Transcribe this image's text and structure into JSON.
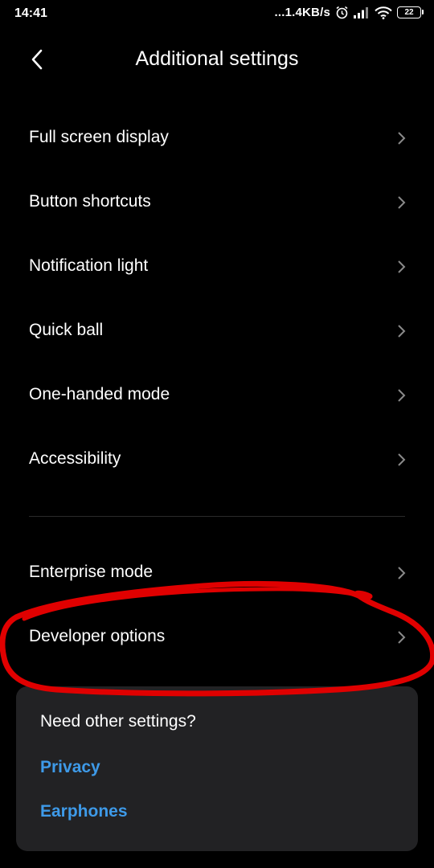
{
  "status_bar": {
    "time": "14:41",
    "net_speed": "...1.4KB/s",
    "battery": "22",
    "icons": [
      "alarm-icon",
      "signal-icon",
      "wifi-icon",
      "battery-icon"
    ]
  },
  "header": {
    "title": "Additional settings",
    "back_icon": "back-arrow-icon"
  },
  "settings": {
    "group1": [
      {
        "label": "Full screen display"
      },
      {
        "label": "Button shortcuts"
      },
      {
        "label": "Notification light"
      },
      {
        "label": "Quick ball"
      },
      {
        "label": "One-handed mode"
      },
      {
        "label": "Accessibility"
      }
    ],
    "group2": [
      {
        "label": "Enterprise mode"
      },
      {
        "label": "Developer options"
      }
    ]
  },
  "card": {
    "title": "Need other settings?",
    "links": [
      {
        "label": "Privacy"
      },
      {
        "label": "Earphones"
      }
    ]
  },
  "colors": {
    "background": "#000000",
    "card": "#222224",
    "link": "#3e9ae8",
    "annotation": "#e00000"
  }
}
